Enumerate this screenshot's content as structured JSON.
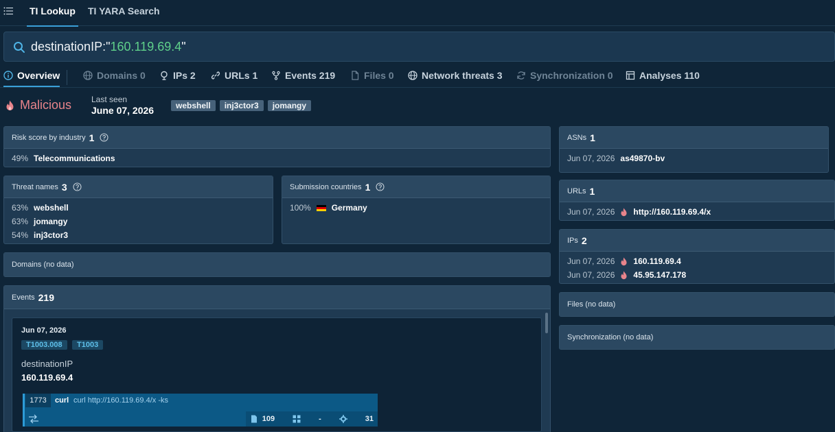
{
  "top_tabs": [
    {
      "label": "TI Lookup",
      "active": true
    },
    {
      "label": "TI YARA Search",
      "active": false
    }
  ],
  "search": {
    "key": "destinationIP:\"",
    "value": "160.119.69.4",
    "suffix": "\""
  },
  "sub_tabs": [
    {
      "label": "Overview",
      "state": "active",
      "icon": "info-icon"
    },
    {
      "label": "Domains 0",
      "state": "dim",
      "icon": "globe-icon"
    },
    {
      "label": "IPs 2",
      "state": "normal",
      "icon": "pin-icon"
    },
    {
      "label": "URLs 1",
      "state": "normal",
      "icon": "link-icon"
    },
    {
      "label": "Events 219",
      "state": "normal",
      "icon": "branch-icon"
    },
    {
      "label": "Files 0",
      "state": "dim",
      "icon": "file-icon"
    },
    {
      "label": "Network threats 3",
      "state": "normal",
      "icon": "globe-icon"
    },
    {
      "label": "Synchronization 0",
      "state": "dim",
      "icon": "sync-icon"
    },
    {
      "label": "Analyses 110",
      "state": "normal",
      "icon": "table-icon"
    }
  ],
  "verdict": {
    "label": "Malicious",
    "color": "#e8848b"
  },
  "last_seen": {
    "label": "Last seen",
    "date": "June 07, 2026"
  },
  "tags": [
    "webshell",
    "inj3ctor3",
    "jomangy"
  ],
  "risk": {
    "title": "Risk score by industry",
    "count": "1",
    "rows": [
      {
        "pct": "49%",
        "label": "Telecommunications"
      }
    ]
  },
  "threat_names": {
    "title": "Threat names",
    "count": "3",
    "rows": [
      {
        "pct": "63%",
        "label": "webshell"
      },
      {
        "pct": "63%",
        "label": "jomangy"
      },
      {
        "pct": "54%",
        "label": "inj3ctor3"
      }
    ]
  },
  "submission_countries": {
    "title": "Submission countries",
    "count": "1",
    "rows": [
      {
        "pct": "100%",
        "label": "Germany"
      }
    ]
  },
  "domains": {
    "title": "Domains (no data)"
  },
  "events": {
    "title": "Events",
    "count": "219",
    "card": {
      "date": "Jun 07, 2026",
      "mitre": [
        "T1003.008",
        "T1003"
      ],
      "key": "destinationIP",
      "value": "160.119.69.4",
      "process": {
        "pid": "1773",
        "name": "curl",
        "cmd": "curl http://160.119.69.4/x -ks",
        "files": "109",
        "modules": "-",
        "registry": "31"
      }
    }
  },
  "asns": {
    "title": "ASNs",
    "count": "1",
    "rows": [
      {
        "date": "Jun 07, 2026",
        "label": "as49870-bv"
      }
    ]
  },
  "urls": {
    "title": "URLs",
    "count": "1",
    "rows": [
      {
        "date": "Jun 07, 2026",
        "label": "http://160.119.69.4/x"
      }
    ]
  },
  "ips": {
    "title": "IPs",
    "count": "2",
    "rows": [
      {
        "date": "Jun 07, 2026",
        "label": "160.119.69.4"
      },
      {
        "date": "Jun 07, 2026",
        "label": "45.95.147.178"
      }
    ]
  },
  "files": {
    "title": "Files (no data)"
  },
  "sync": {
    "title": "Synchronization (no data)"
  },
  "colors": {
    "accent": "#3aa0d8",
    "malicious": "#e8848b",
    "search_value": "#5fd08a"
  }
}
